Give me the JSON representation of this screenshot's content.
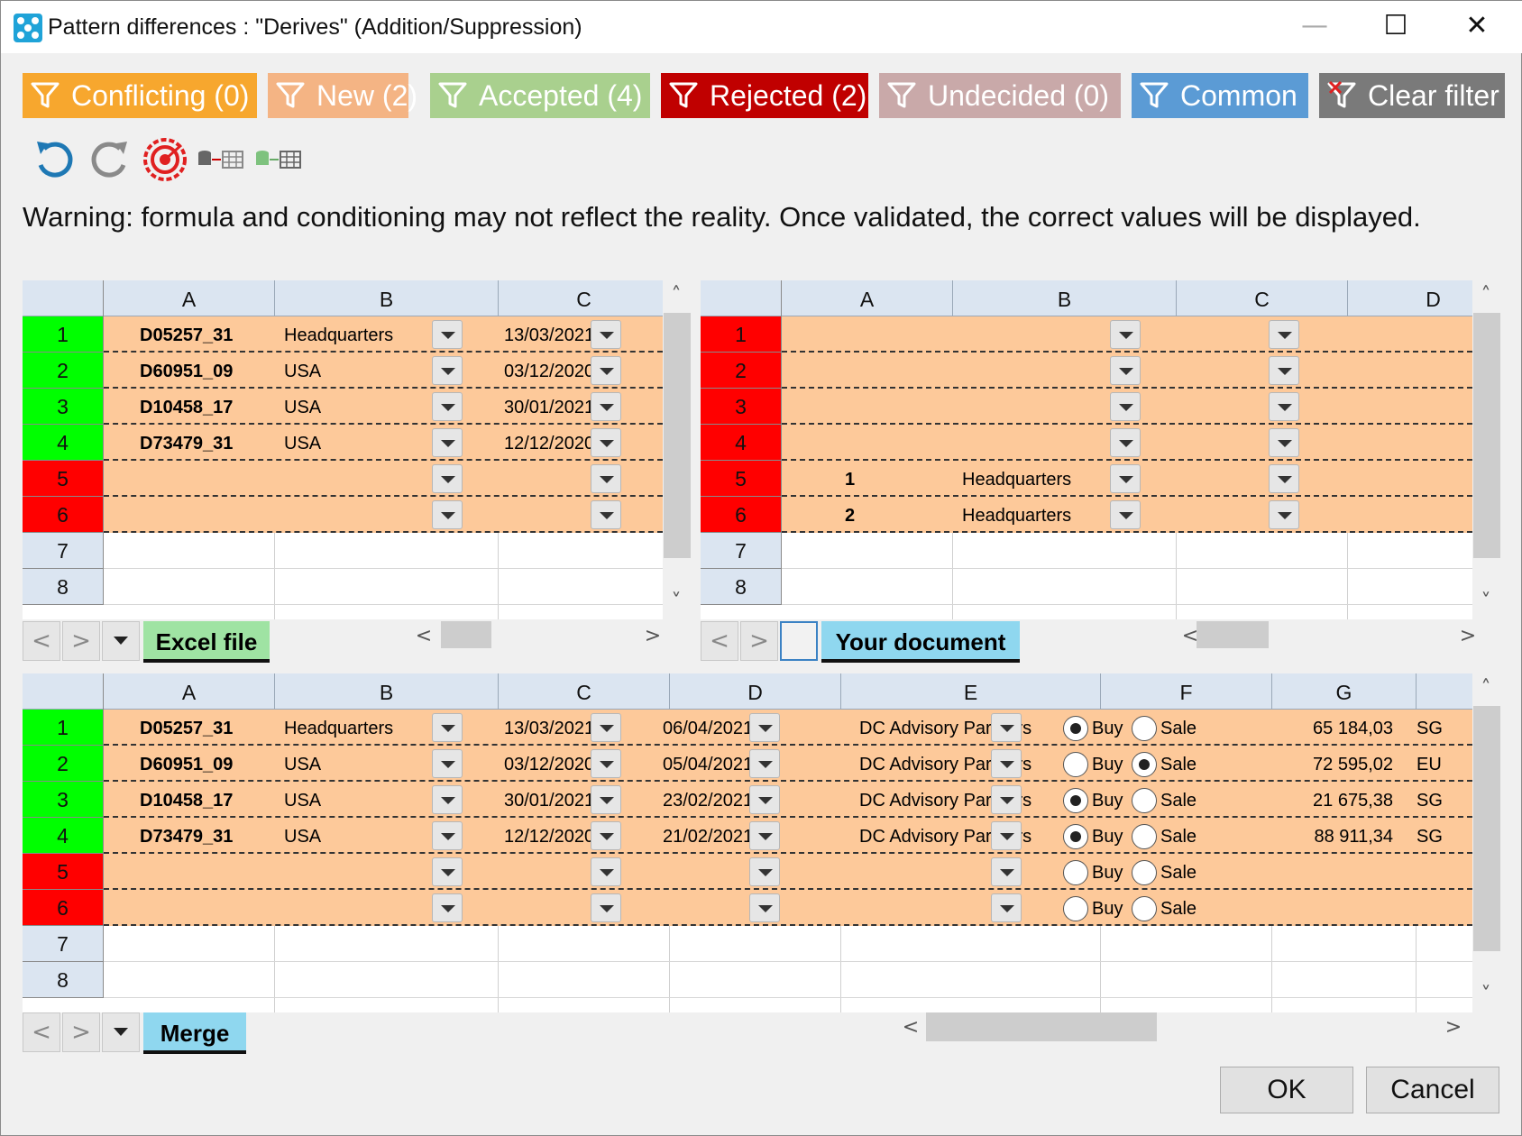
{
  "window": {
    "title": "Pattern differences : \"Derives\" (Addition/Suppression)",
    "minimize_glyph": "—",
    "maximize_glyph": "☐",
    "close_glyph": "✕"
  },
  "filters": [
    {
      "label": "Conflicting (0)",
      "color": "#f7a72e"
    },
    {
      "label": "New (2)",
      "color": "#f4b484"
    },
    {
      "label": "Accepted (4)",
      "color": "#a9d08e"
    },
    {
      "label": "Rejected (2)",
      "color": "#c00000"
    },
    {
      "label": "Undecided (0)",
      "color": "#c9a9a9"
    },
    {
      "label": "Common",
      "color": "#5b9bd5"
    },
    {
      "label": "Clear filter",
      "color": "#7a7a7a"
    }
  ],
  "toolbar": [
    "undo-icon",
    "redo-icon",
    "reset-target-icon",
    "database-to-table-icon",
    "database-to-table-green-icon"
  ],
  "warning": "Warning: formula and conditioning may not reflect the reality. Once validated, the correct values will be displayed.",
  "colors": {
    "accepted": "#00ff00",
    "rejected": "#ff0000",
    "row_fill": "#fdc99a",
    "header": "#dbe5f1",
    "tab_excel": "#9fe3a3",
    "tab_blue": "#8fd7ef"
  },
  "excel_grid": {
    "columns": [
      "A",
      "B",
      "C"
    ],
    "row_numbers": [
      "1",
      "2",
      "3",
      "4",
      "5",
      "6",
      "7",
      "8"
    ],
    "rows": [
      {
        "status": "accepted",
        "a": "D05257_31",
        "b": "Headquarters",
        "c": "13/03/2021"
      },
      {
        "status": "accepted",
        "a": "D60951_09",
        "b": "USA",
        "c": "03/12/2020"
      },
      {
        "status": "accepted",
        "a": "D10458_17",
        "b": "USA",
        "c": "30/01/2021"
      },
      {
        "status": "accepted",
        "a": "D73479_31",
        "b": "USA",
        "c": "12/12/2020"
      },
      {
        "status": "rejected",
        "a": "",
        "b": "",
        "c": ""
      },
      {
        "status": "rejected",
        "a": "",
        "b": "",
        "c": ""
      }
    ],
    "tab": "Excel file"
  },
  "doc_grid": {
    "columns": [
      "A",
      "B",
      "C",
      "D"
    ],
    "row_numbers": [
      "1",
      "2",
      "3",
      "4",
      "5",
      "6",
      "7",
      "8"
    ],
    "rows": [
      {
        "status": "rejected",
        "a": "",
        "b": ""
      },
      {
        "status": "rejected",
        "a": "",
        "b": ""
      },
      {
        "status": "rejected",
        "a": "",
        "b": ""
      },
      {
        "status": "rejected",
        "a": "",
        "b": ""
      },
      {
        "status": "rejected",
        "a": "1",
        "b": "Headquarters"
      },
      {
        "status": "rejected",
        "a": "2",
        "b": "Headquarters"
      }
    ],
    "tab": "Your document"
  },
  "merge_grid": {
    "columns": [
      "A",
      "B",
      "C",
      "D",
      "E",
      "F",
      "G"
    ],
    "row_numbers": [
      "1",
      "2",
      "3",
      "4",
      "5",
      "6",
      "7",
      "8"
    ],
    "buy_label": "Buy",
    "sale_label": "Sale",
    "rows": [
      {
        "status": "accepted",
        "a": "D05257_31",
        "b": "Headquarters",
        "c": "13/03/2021",
        "d": "06/04/2021",
        "e": "DC Advisory Partners",
        "choice": "buy",
        "g": "65 184,03",
        "h": "SG"
      },
      {
        "status": "accepted",
        "a": "D60951_09",
        "b": "USA",
        "c": "03/12/2020",
        "d": "05/04/2021",
        "e": "DC Advisory Partners",
        "choice": "sale",
        "g": "72 595,02",
        "h": "EU"
      },
      {
        "status": "accepted",
        "a": "D10458_17",
        "b": "USA",
        "c": "30/01/2021",
        "d": "23/02/2021",
        "e": "DC Advisory Partners",
        "choice": "buy",
        "g": "21 675,38",
        "h": "SG"
      },
      {
        "status": "accepted",
        "a": "D73479_31",
        "b": "USA",
        "c": "12/12/2020",
        "d": "21/02/2021",
        "e": "DC Advisory Partners",
        "choice": "buy",
        "g": "88 911,34",
        "h": "SG"
      },
      {
        "status": "rejected",
        "a": "",
        "b": "",
        "c": "",
        "d": "",
        "e": "",
        "choice": "none",
        "g": "",
        "h": ""
      },
      {
        "status": "rejected",
        "a": "",
        "b": "",
        "c": "",
        "d": "",
        "e": "",
        "choice": "none",
        "g": "",
        "h": ""
      }
    ],
    "tab": "Merge"
  },
  "nav": {
    "prev": "<",
    "next": ">",
    "up": "˄",
    "down": "˅",
    "left": "<",
    "right": ">"
  },
  "buttons": {
    "ok": "OK",
    "cancel": "Cancel"
  }
}
